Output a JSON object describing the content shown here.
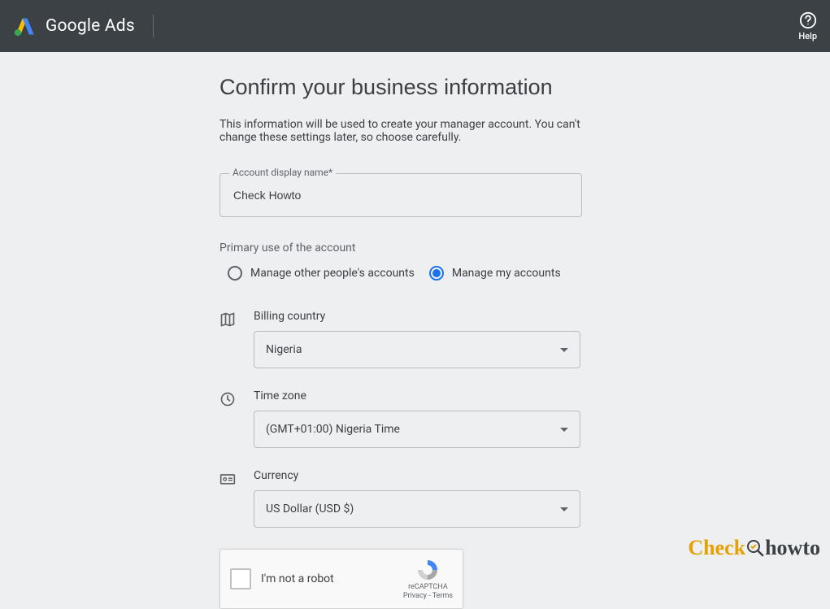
{
  "header": {
    "product_name": "Google Ads",
    "help_label": "Help"
  },
  "main": {
    "title": "Confirm your business information",
    "subtitle": "This information will be used to create your manager account. You can't change these settings later, so choose carefully.",
    "account_name": {
      "label": "Account display name*",
      "value": "Check Howto"
    },
    "primary_use": {
      "label": "Primary use of the account",
      "options": [
        {
          "label": "Manage other people's accounts",
          "selected": false
        },
        {
          "label": "Manage my accounts",
          "selected": true
        }
      ]
    },
    "billing_country": {
      "label": "Billing country",
      "value": "Nigeria"
    },
    "time_zone": {
      "label": "Time zone",
      "value": "(GMT+01:00) Nigeria Time"
    },
    "currency": {
      "label": "Currency",
      "value": "US Dollar (USD $)"
    },
    "recaptcha": {
      "text": "I'm not a robot",
      "brand": "reCAPTCHA",
      "links": "Privacy - Terms"
    }
  },
  "watermark": {
    "part1": "Check",
    "part2": "howto"
  }
}
